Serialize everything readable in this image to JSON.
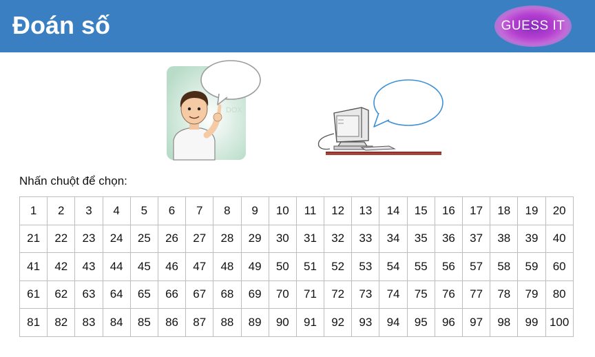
{
  "header": {
    "title": "Đoán số",
    "logo_text": "GUESS IT",
    "background": "#3a7fc2",
    "logo_color": "#b43fd0"
  },
  "illustrations": {
    "person_watermark": "DOX",
    "person_icon": "thinking-person-icon",
    "computer_icon": "computer-speech-icon"
  },
  "instruction": "Nhấn chuột để chọn:",
  "grid": {
    "rows": [
      [
        "1",
        "2",
        "3",
        "4",
        "5",
        "6",
        "7",
        "8",
        "9",
        "10",
        "11",
        "12",
        "13",
        "14",
        "15",
        "16",
        "17",
        "18",
        "19",
        "20"
      ],
      [
        "21",
        "22",
        "23",
        "24",
        "25",
        "26",
        "27",
        "28",
        "29",
        "30",
        "31",
        "32",
        "33",
        "34",
        "35",
        "36",
        "37",
        "38",
        "39",
        "40"
      ],
      [
        "41",
        "42",
        "43",
        "44",
        "45",
        "46",
        "47",
        "48",
        "49",
        "50",
        "51",
        "52",
        "53",
        "54",
        "55",
        "56",
        "57",
        "58",
        "59",
        "60"
      ],
      [
        "61",
        "62",
        "63",
        "64",
        "65",
        "66",
        "67",
        "68",
        "69",
        "70",
        "71",
        "72",
        "73",
        "74",
        "75",
        "76",
        "77",
        "78",
        "79",
        "80"
      ],
      [
        "81",
        "82",
        "83",
        "84",
        "85",
        "86",
        "87",
        "88",
        "89",
        "90",
        "91",
        "92",
        "93",
        "94",
        "95",
        "96",
        "97",
        "98",
        "99",
        "100"
      ]
    ]
  }
}
